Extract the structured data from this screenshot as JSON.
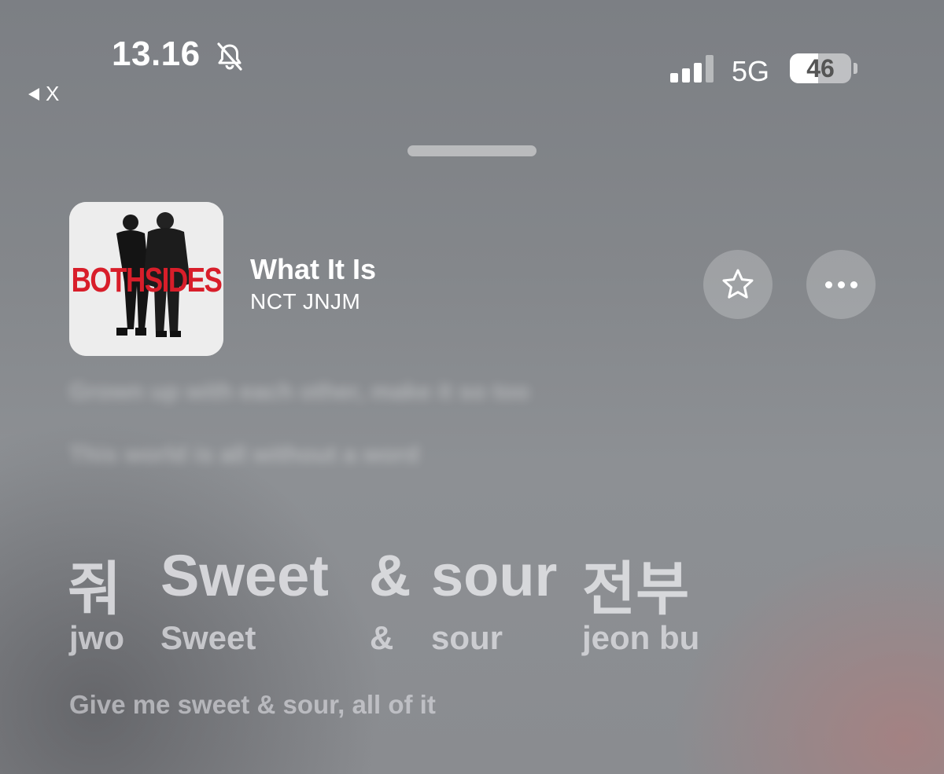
{
  "status_bar": {
    "time": "13.16",
    "back_label": "X",
    "network": "5G",
    "battery_level": "46",
    "signal_bars_active": 3,
    "signal_bars_total": 4
  },
  "now_playing": {
    "album_art_text": "BOTHSIDES",
    "title": "What It Is",
    "artist": "NCT JNJM"
  },
  "lyrics": {
    "previous_lines_blurred": [
      "Grown up with each other, make it so too",
      "This world is all without a word"
    ],
    "current": {
      "words": [
        {
          "main": "줘",
          "romanization": "jwo"
        },
        {
          "main": "Sweet",
          "romanization": "Sweet"
        },
        {
          "main": "&",
          "romanization": "&"
        },
        {
          "main": "sour",
          "romanization": "sour"
        },
        {
          "main": "전부",
          "romanization": "jeon bu"
        }
      ],
      "translation": "Give me sweet & sour, all of it"
    }
  },
  "icons": [
    "bell-slash-icon",
    "back-arrow-icon",
    "signal-icon",
    "battery-icon",
    "star-icon",
    "ellipsis-icon"
  ]
}
